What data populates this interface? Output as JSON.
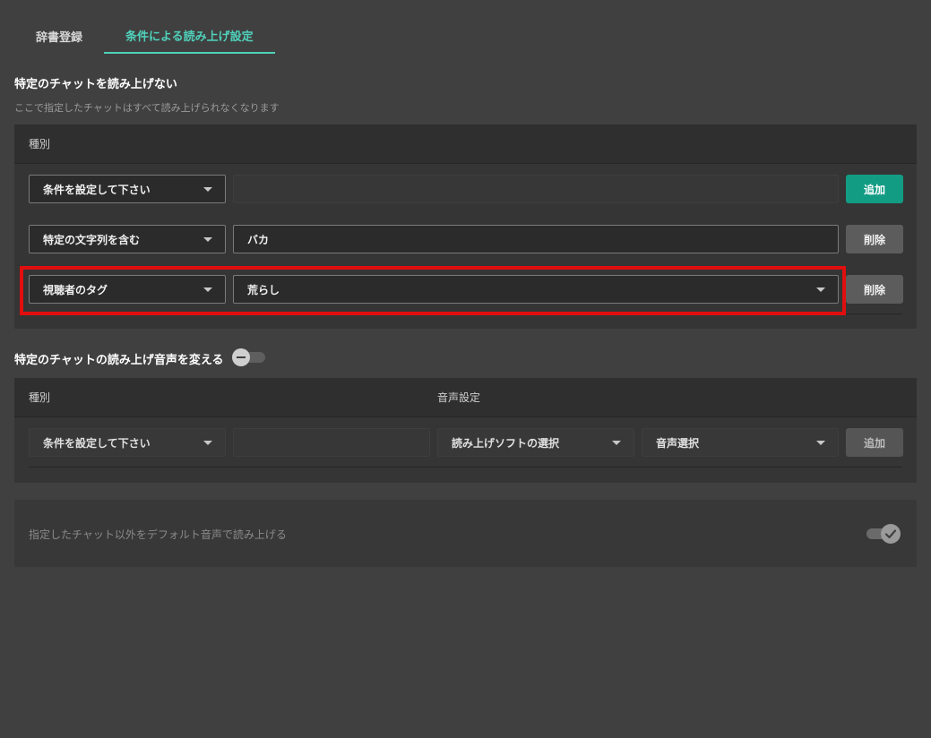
{
  "tabs": [
    {
      "label": "辞書登録",
      "active": false
    },
    {
      "label": "条件による読み上げ設定",
      "active": true
    }
  ],
  "section1": {
    "title": "特定のチャットを読み上げない",
    "description": "ここで指定したチャットはすべて読み上げられなくなります",
    "header": "種別",
    "new_row": {
      "condition": "条件を設定して下さい",
      "value": "",
      "button": "追加"
    },
    "rows": [
      {
        "condition": "特定の文字列を含む",
        "value": "バカ",
        "button": "削除"
      },
      {
        "condition": "視聴者のタグ",
        "value": "荒らし",
        "button": "削除"
      }
    ]
  },
  "section2": {
    "title": "特定のチャットの読み上げ音声を変える",
    "toggle_on": false,
    "header_type": "種別",
    "header_voice": "音声設定",
    "new_row": {
      "condition": "条件を設定して下さい",
      "value": "",
      "software": "読み上げソフトの選択",
      "voice": "音声選択",
      "button": "追加"
    }
  },
  "section3": {
    "label": "指定したチャット以外をデフォルト音声で読み上げる",
    "toggle_on": true
  },
  "colors": {
    "accent": "#4fd1bb",
    "primary_button": "#129c84",
    "highlight": "#e10e0e",
    "background": "#404040"
  }
}
